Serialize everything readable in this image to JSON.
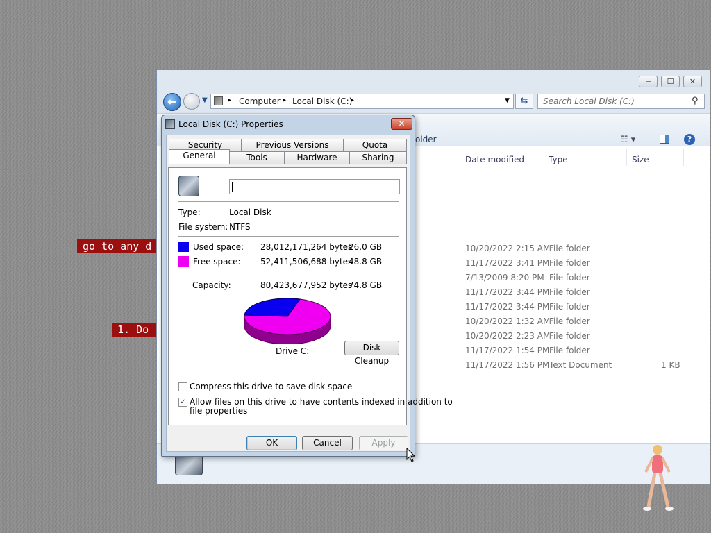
{
  "desktop": {
    "banners": [
      "go to any d",
      "",
      "1. Do"
    ]
  },
  "explorer": {
    "window_buttons": {
      "minimize": "─",
      "maximize": "☐",
      "close": "✕"
    },
    "address": {
      "crumbs": [
        "Computer",
        "Local Disk (C:)"
      ],
      "separator": "▸"
    },
    "search": {
      "placeholder": "Search Local Disk (C:)"
    },
    "toolbar": {
      "partial_label": "older"
    },
    "columns": {
      "date": "Date modified",
      "type": "Type",
      "size": "Size"
    },
    "rows": [
      {
        "date": "10/20/2022 2:15 AM",
        "type": "File folder",
        "size": ""
      },
      {
        "date": "11/17/2022 3:41 PM",
        "type": "File folder",
        "size": ""
      },
      {
        "date": "7/13/2009 8:20 PM",
        "type": "File folder",
        "size": ""
      },
      {
        "date": "11/17/2022 3:44 PM",
        "type": "File folder",
        "size": ""
      },
      {
        "date": "11/17/2022 3:44 PM",
        "type": "File folder",
        "size": ""
      },
      {
        "date": "10/20/2022 1:32 AM",
        "type": "File folder",
        "size": ""
      },
      {
        "date": "10/20/2022 2:23 AM",
        "type": "File folder",
        "size": ""
      },
      {
        "date": "11/17/2022 1:54 PM",
        "type": "File folder",
        "size": ""
      },
      {
        "date": "11/17/2022 1:56 PM",
        "type": "Text Document",
        "size": "1 KB"
      }
    ]
  },
  "dialog": {
    "title": "Local Disk (C:) Properties",
    "close": "✕",
    "tabs_back": [
      "Security",
      "Previous Versions",
      "Quota"
    ],
    "tabs_front": [
      "General",
      "Tools",
      "Hardware",
      "Sharing"
    ],
    "active_tab": "General",
    "name_value": "",
    "type_label": "Type:",
    "type_value": "Local Disk",
    "fs_label": "File system:",
    "fs_value": "NTFS",
    "used": {
      "label": "Used space:",
      "bytes": "28,012,171,264 bytes",
      "gb": "26.0 GB",
      "color": "#0a00f0"
    },
    "free": {
      "label": "Free space:",
      "bytes": "52,411,506,688 bytes",
      "gb": "48.8 GB",
      "color": "#f000f0"
    },
    "capacity": {
      "label": "Capacity:",
      "bytes": "80,423,677,952 bytes",
      "gb": "74.8 GB"
    },
    "drive_label": "Drive C:",
    "disk_cleanup": "Disk Cleanup",
    "compress_label": "Compress this drive to save disk space",
    "compress_checked": false,
    "index_label_1": "Allow files on this drive to have contents indexed in addition to",
    "index_label_2": "file properties",
    "index_checked": true,
    "check_glyph": "✓",
    "ok": "OK",
    "cancel": "Cancel",
    "apply": "Apply"
  }
}
